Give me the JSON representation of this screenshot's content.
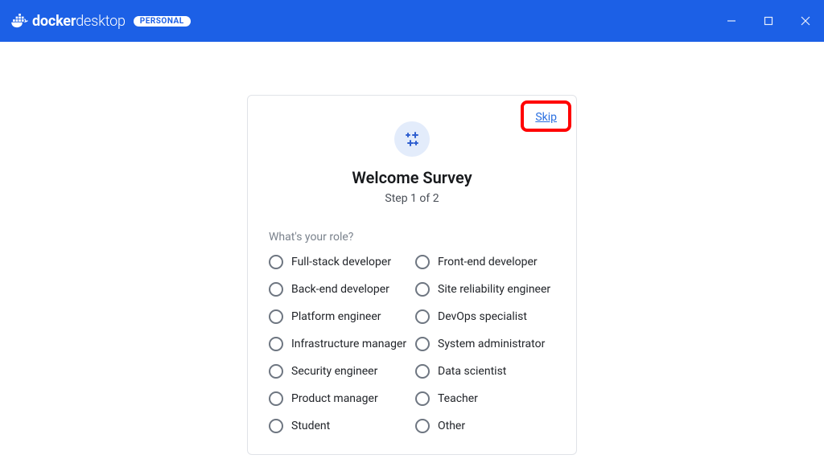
{
  "titlebar": {
    "brand_bold": "docker",
    "brand_light": "desktop",
    "badge": "PERSONAL"
  },
  "survey": {
    "skip": "Skip",
    "title": "Welcome Survey",
    "step": "Step 1 of 2",
    "question": "What's your role?",
    "options": [
      "Full-stack developer",
      "Front-end developer",
      "Back-end developer",
      "Site reliability engineer",
      "Platform engineer",
      "DevOps specialist",
      "Infrastructure manager",
      "System administrator",
      "Security engineer",
      "Data scientist",
      "Product manager",
      "Teacher",
      "Student",
      "Other"
    ]
  }
}
